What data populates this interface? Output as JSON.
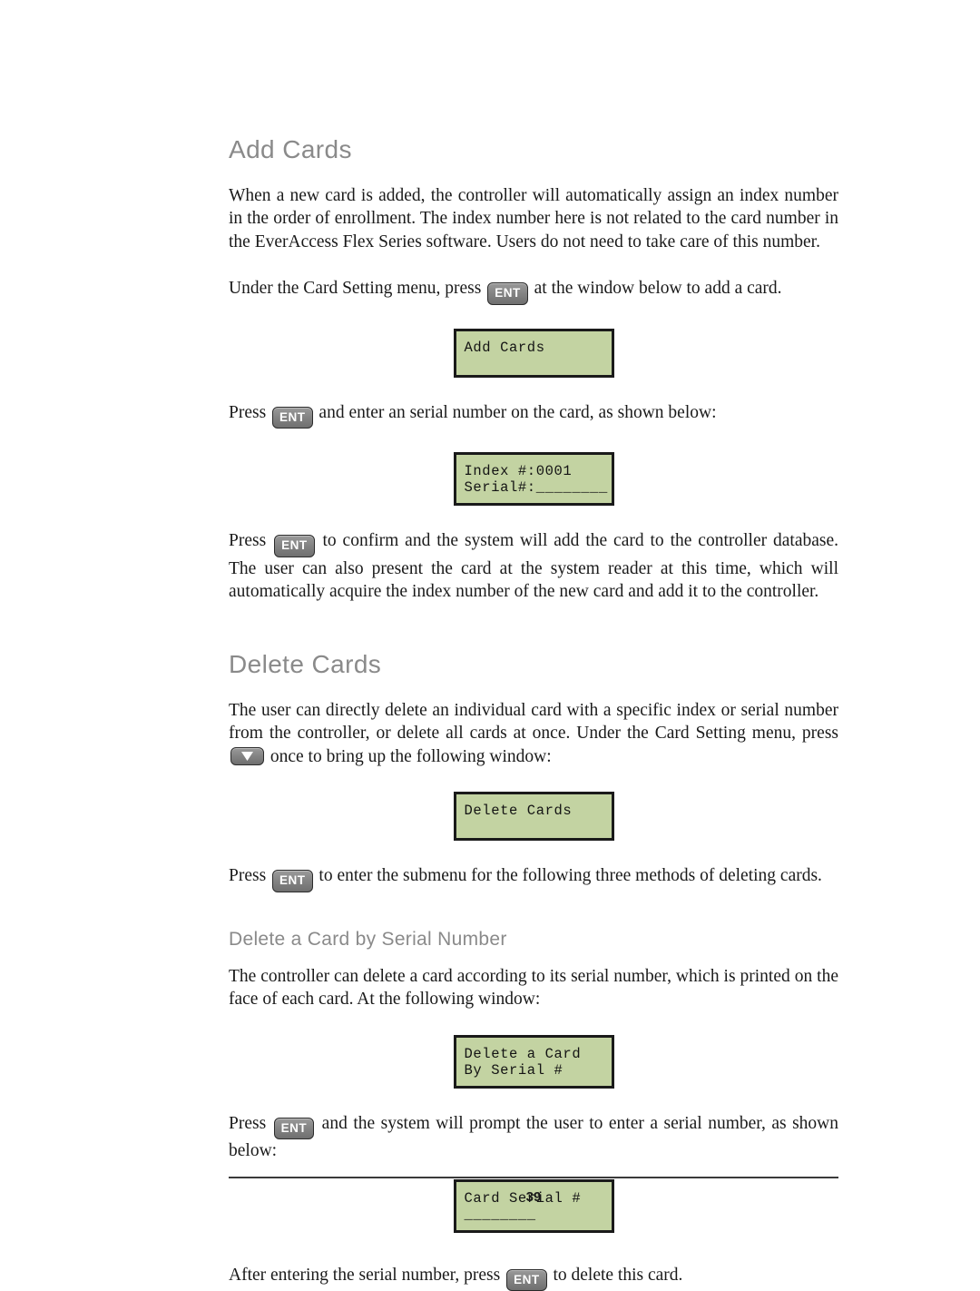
{
  "document": {
    "page_number": "39"
  },
  "sections": {
    "add_cards": {
      "heading": "Add Cards",
      "intro_paragraph": "When a new card is added, the controller will automatically assign an index number in the order of enrollment. The index number here is not related to the card number in the EverAccess Flex Series software. Users do not need to take care of this number.",
      "instruction_before_key": "Under the Card Setting menu, press",
      "instruction_after_key": "at the window below to add a card.",
      "lcd_add_cards": {
        "line1": "Add Cards",
        "line2": ""
      },
      "press_enter_serial_before": "Press",
      "press_enter_serial_after": "and enter an serial number on the card, as shown below:",
      "lcd_index": {
        "line1": "Index #:0001",
        "line2": "Serial#:________"
      },
      "confirm_before_key": "Press",
      "confirm_after_key": "to confirm and the system will add the card to the controller database. The user can also present the card at the system reader at this time, which will automatically acquire the index number of the new card and add it to the controller."
    },
    "delete_cards": {
      "heading": "Delete Cards",
      "intro_before_key": "The user can directly delete an individual card with a specific index or serial number from the controller, or delete all cards at once. Under the Card Setting menu, press",
      "intro_after_key": "once to bring up the following window:",
      "lcd_delete_cards": {
        "line1": "Delete Cards",
        "line2": ""
      },
      "submenu_before_key": "Press",
      "submenu_after_key": "to enter the submenu for the following three methods of deleting cards.",
      "subsection": {
        "heading": "Delete a Card by Serial Number",
        "paragraph": "The controller can delete a card according to its serial number, which is printed on the face of each card. At the following window:",
        "lcd_delete_by_serial": {
          "line1": "Delete a Card",
          "line2": "By Serial #"
        },
        "prompt_before_key": "Press",
        "prompt_after_key": "and the system will prompt the user to enter a serial number, as shown below:",
        "lcd_card_serial": {
          "line1": "Card Serial #",
          "line2": "________"
        },
        "closing_before_key": "After entering the serial number, press",
        "closing_after_key": "to delete this card."
      }
    }
  },
  "keys": {
    "enter": "ENT",
    "down_arrow": "down-arrow"
  },
  "colors": {
    "lcd_background": "#c3d3a2",
    "lcd_border": "#1a1a1a",
    "heading_gray": "#8a8a8a",
    "key_gray": "#858585"
  }
}
